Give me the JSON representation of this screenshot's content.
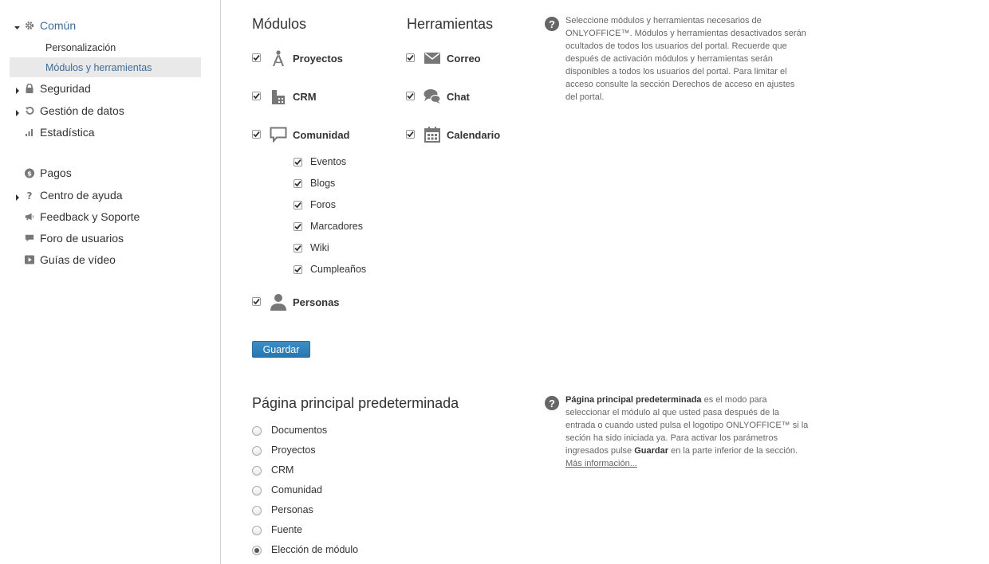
{
  "sidebar": {
    "common": "Común",
    "personalization": "Personalización",
    "modules_tools": "Módulos y herramientas",
    "security": "Seguridad",
    "data_management": "Gestión de datos",
    "statistics": "Estadística",
    "payments": "Pagos",
    "help_center": "Centro de ayuda",
    "feedback": "Feedback y Soporte",
    "user_forum": "Foro de usuarios",
    "video_guides": "Guías de vídeo"
  },
  "modules": {
    "title": "Módulos",
    "projects": "Proyectos",
    "crm": "CRM",
    "community": "Comunidad",
    "events": "Eventos",
    "blogs": "Blogs",
    "forums": "Foros",
    "bookmarks": "Marcadores",
    "wiki": "Wiki",
    "birthdays": "Cumpleaños",
    "people": "Personas"
  },
  "tools": {
    "title": "Herramientas",
    "mail": "Correo",
    "chat": "Chat",
    "calendar": "Calendario"
  },
  "help1": {
    "text": "Seleccione módulos y herramientas necesarios de ONLYOFFICE™. Módulos y herramientas desactivados serán ocultados de todos los usuarios del portal. Recuerde que después de activación módulos y herramientas serán disponibles a todos los usuarios del portal. Para limitar el acceso consulte la sección Derechos de acceso en ajustes del portal."
  },
  "save_button": "Guardar",
  "default_page": {
    "title": "Página principal predeterminada",
    "options": [
      "Documentos",
      "Proyectos",
      "CRM",
      "Comunidad",
      "Personas",
      "Fuente",
      "Elección de módulo"
    ],
    "selected": "Elección de módulo"
  },
  "help2": {
    "bold": "Página principal predeterminada",
    "text1": " es el modo para seleccionar el módulo al que usted pasa después de la entrada o cuando usted pulsa el logotipo ONLYOFFICE™ si la seción ha sido iniciada ya. Para activar los parámetros ingresados pulse ",
    "bold2": "Guardar",
    "text2": " en la parte inferior de la sección.",
    "link": "Más información..."
  },
  "colors": {
    "accent": "#3a6e9b",
    "button": "#2a76ad",
    "icon": "#777777"
  }
}
